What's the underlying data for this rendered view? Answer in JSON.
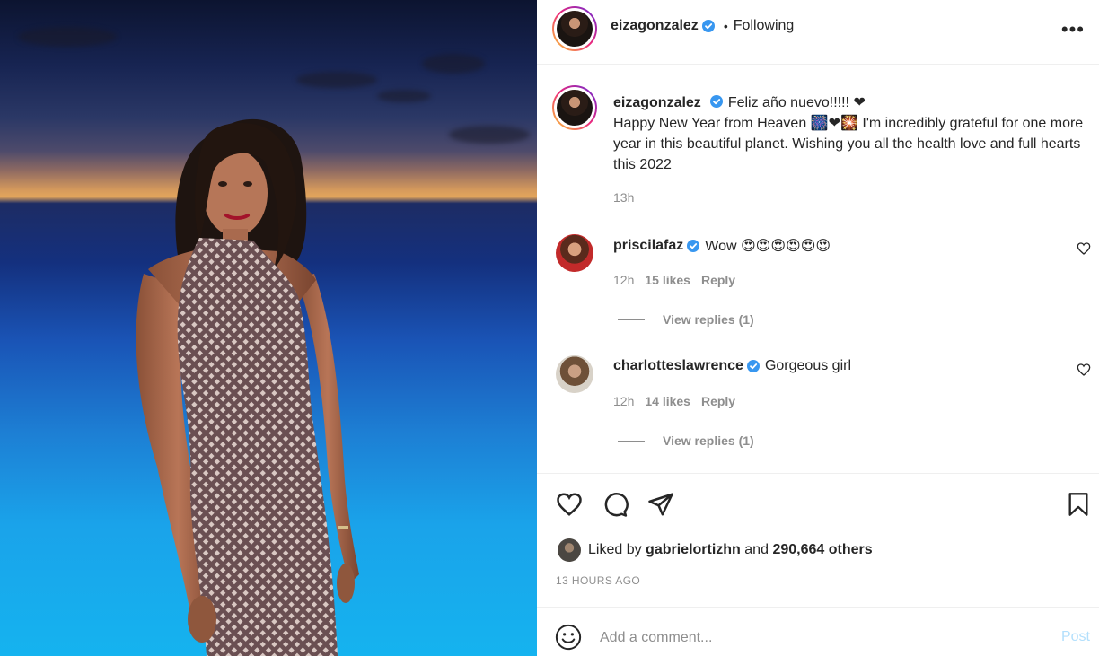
{
  "post": {
    "username": "eizagonzalez",
    "following_label": "Following",
    "separator": "•",
    "more_icon": "more-options-icon",
    "caption_title": "Feliz año nuevo!!!!! ❤",
    "caption_text": "Happy New Year from Heaven 🎆❤🎇 I'm incredibly grateful for one more year in this beautiful planet. Wishing you all the health love and full hearts this 2022",
    "caption_time": "13h"
  },
  "comments": [
    {
      "username": "priscilafaz",
      "text": "Wow 😍😍😍😍😍😍",
      "time": "12h",
      "likes": "15 likes",
      "reply_label": "Reply",
      "view_replies": "View replies (1)"
    },
    {
      "username": "charlotteslawrence",
      "text": "Gorgeous girl",
      "time": "12h",
      "likes": "14 likes",
      "reply_label": "Reply",
      "view_replies": "View replies (1)"
    }
  ],
  "engagement": {
    "liked_by_prefix": "Liked by",
    "liked_by_user": "gabrielortizhn",
    "liked_by_and": "and",
    "liked_by_count": "290,664 others",
    "timestamp": "13 HOURS AGO"
  },
  "composer": {
    "placeholder": "Add a comment...",
    "post_label": "Post"
  },
  "colors": {
    "verified": "#3897f0",
    "muted": "#8e8e8e",
    "post_disabled": "#b2dffc"
  }
}
